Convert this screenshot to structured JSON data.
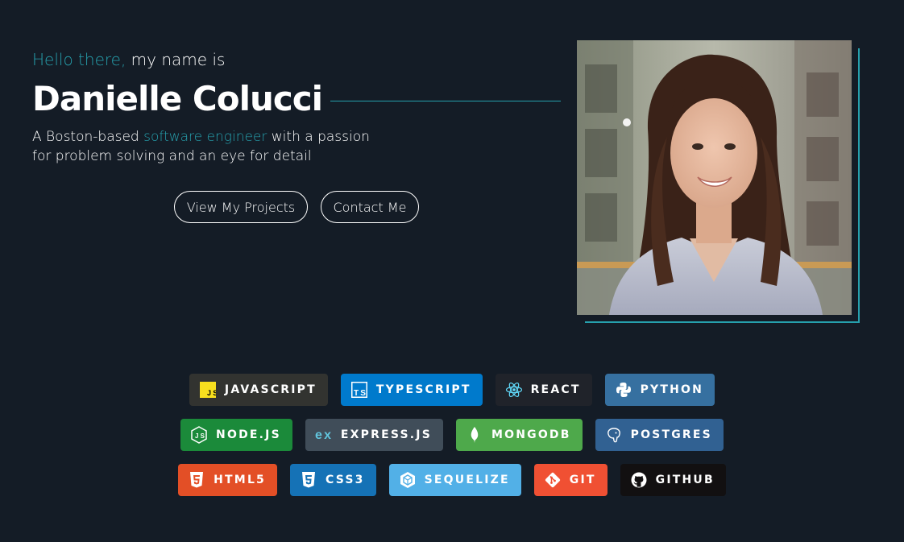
{
  "hero": {
    "greeting_accent": "Hello there,",
    "greeting_rest": " my name is",
    "name": "Danielle Colucci",
    "tagline_before": "A Boston-based ",
    "tagline_accent": "software engineer",
    "tagline_after": " with a passion for problem solving and an eye for detail"
  },
  "buttons": {
    "projects": "View My Projects",
    "contact": "Contact Me"
  },
  "colors": {
    "background": "#141c26",
    "accent": "#26a0ad"
  },
  "badges": [
    {
      "label": "JAVASCRIPT",
      "icon": "javascript-icon",
      "color": "#323330"
    },
    {
      "label": "TYPESCRIPT",
      "icon": "typescript-icon",
      "color": "#007acc"
    },
    {
      "label": "REACT",
      "icon": "react-icon",
      "color": "#20232a"
    },
    {
      "label": "PYTHON",
      "icon": "python-icon",
      "color": "#3670a0"
    },
    {
      "label": "NODE.JS",
      "icon": "nodejs-icon",
      "color": "#1b8a3a"
    },
    {
      "label": "EXPRESS.JS",
      "icon": "express-icon",
      "color": "#404d59"
    },
    {
      "label": "MONGODB",
      "icon": "mongodb-icon",
      "color": "#4ea94b"
    },
    {
      "label": "POSTGRES",
      "icon": "postgres-icon",
      "color": "#316192"
    },
    {
      "label": "HTML5",
      "icon": "html5-icon",
      "color": "#e34f26"
    },
    {
      "label": "CSS3",
      "icon": "css3-icon",
      "color": "#1572b6"
    },
    {
      "label": "SEQUELIZE",
      "icon": "sequelize-icon",
      "color": "#52b0e7"
    },
    {
      "label": "GIT",
      "icon": "git-icon",
      "color": "#f05033"
    },
    {
      "label": "GITHUB",
      "icon": "github-icon",
      "color": "#121011"
    }
  ]
}
